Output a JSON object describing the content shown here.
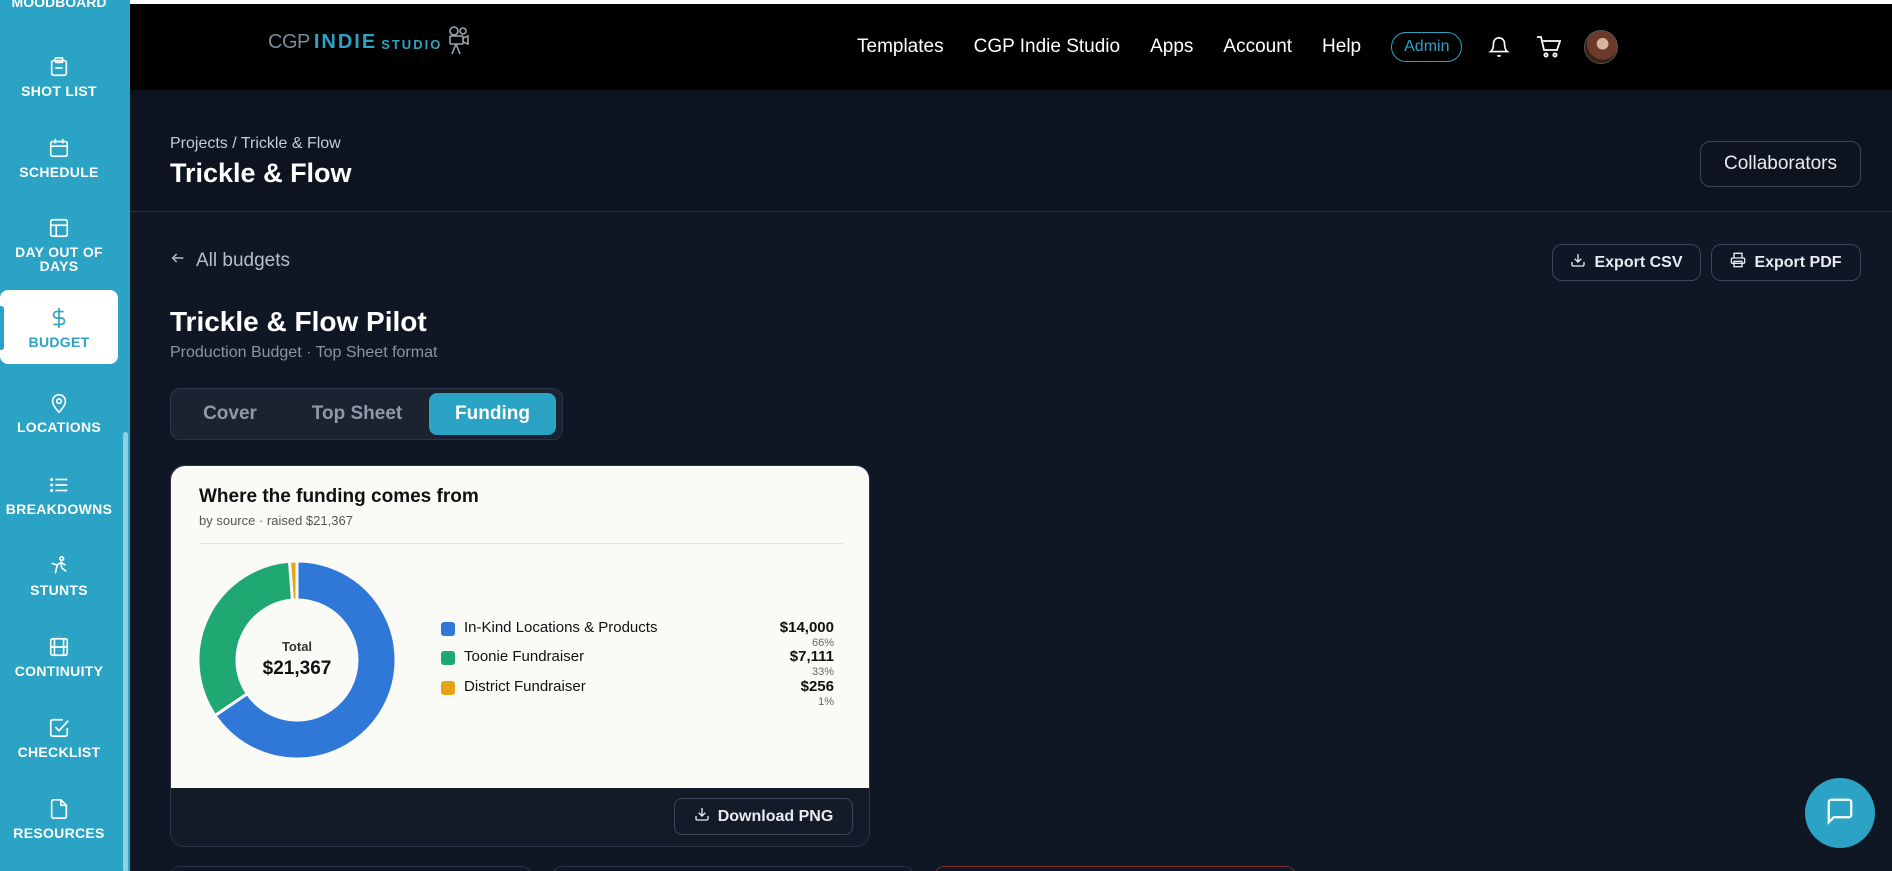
{
  "sidebar": {
    "partial_top_label": "MOODBOARD",
    "items": [
      {
        "label": "SHOT LIST",
        "icon": "clipboard-icon"
      },
      {
        "label": "SCHEDULE",
        "icon": "calendar-icon"
      },
      {
        "label": "DAY OUT OF DAYS",
        "icon": "table-icon"
      },
      {
        "label": "BUDGET",
        "icon": "dollar-icon",
        "active": true
      },
      {
        "label": "LOCATIONS",
        "icon": "map-pin-icon"
      },
      {
        "label": "BREAKDOWNS",
        "icon": "list-icon"
      },
      {
        "label": "STUNTS",
        "icon": "stunt-figure-icon"
      },
      {
        "label": "CONTINUITY",
        "icon": "film-icon"
      },
      {
        "label": "CHECKLIST",
        "icon": "checkbox-icon"
      },
      {
        "label": "RESOURCES",
        "icon": "document-icon"
      }
    ]
  },
  "header": {
    "logo": {
      "part1": "CGP",
      "part2": "INDIE",
      "part3": "STUDIO"
    },
    "nav": [
      "Templates",
      "CGP Indie Studio",
      "Apps",
      "Account",
      "Help"
    ],
    "admin_label": "Admin"
  },
  "page": {
    "breadcrumb_root": "Projects",
    "breadcrumb_sep": "/",
    "breadcrumb_current": "Trickle & Flow",
    "title": "Trickle & Flow",
    "collaborators_label": "Collaborators"
  },
  "budget": {
    "back_label": "All budgets",
    "export_csv_label": "Export CSV",
    "export_pdf_label": "Export PDF",
    "title": "Trickle & Flow Pilot",
    "subtitle": "Production Budget · Top Sheet format",
    "tabs": [
      {
        "label": "Cover",
        "active": false
      },
      {
        "label": "Top Sheet",
        "active": false
      },
      {
        "label": "Funding",
        "active": true
      }
    ]
  },
  "funding_card": {
    "title": "Where the funding comes from",
    "subtitle": "by source · raised $21,367",
    "total_label": "Total",
    "total_value": "$21,367",
    "download_label": "Download PNG"
  },
  "chart_data": {
    "type": "pie",
    "title": "Where the funding comes from",
    "subtitle": "by source · raised $21,367",
    "donut": true,
    "total": 21367,
    "categories": [
      "In-Kind Locations & Products",
      "Toonie Fundraiser",
      "District Fundraiser"
    ],
    "values": [
      14000,
      7111,
      256
    ],
    "value_labels": [
      "$14,000",
      "$7,111",
      "$256"
    ],
    "percent_labels": [
      "66%",
      "33%",
      "1%"
    ],
    "colors": [
      "#2f78d8",
      "#20a872",
      "#e6a414"
    ],
    "legend": "right"
  },
  "colors": {
    "accent": "#2aa3c4",
    "background": "#0f1624",
    "header": "#000000"
  }
}
